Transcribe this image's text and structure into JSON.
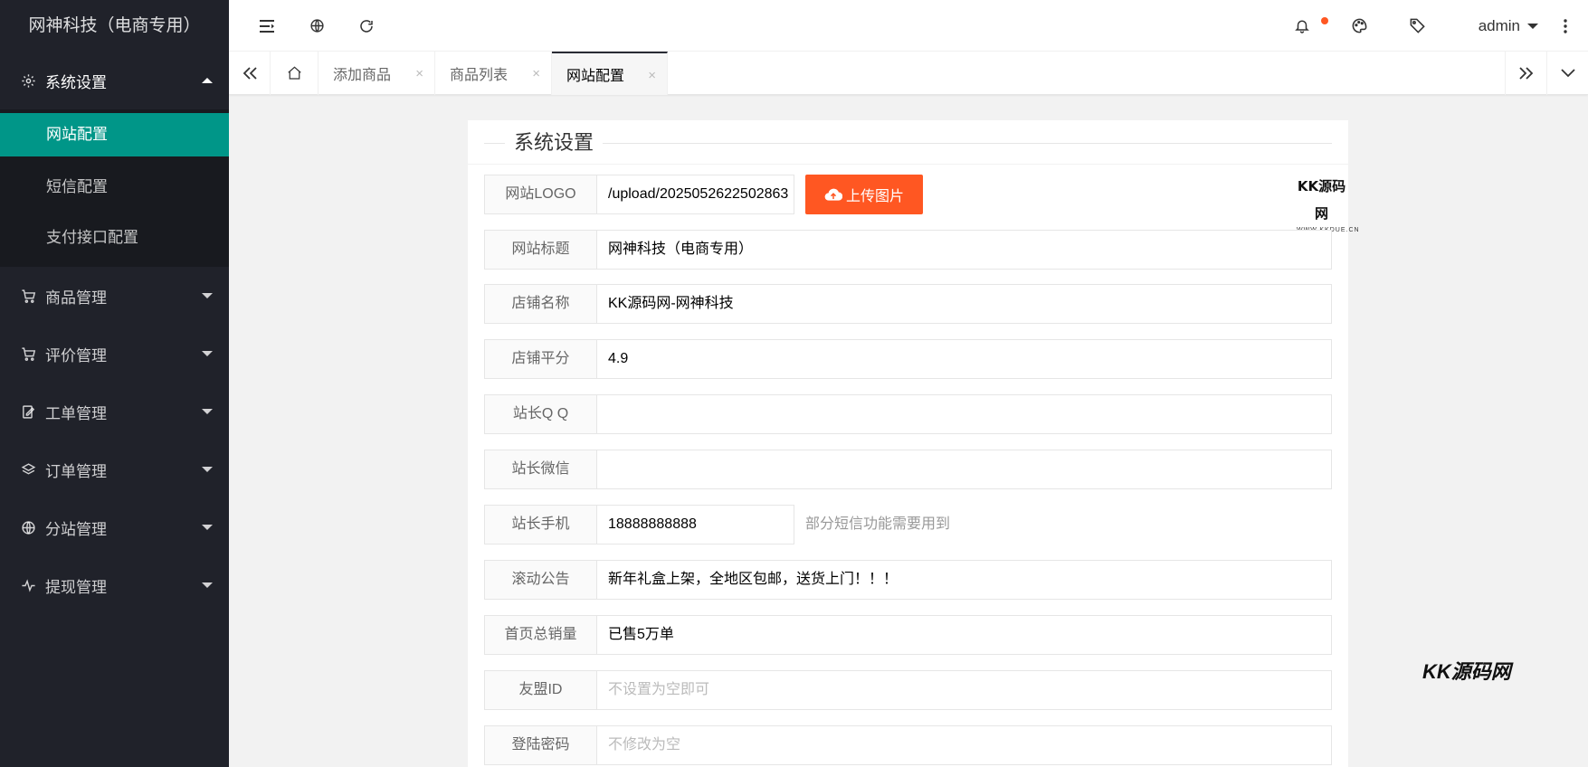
{
  "app": {
    "title": "网神科技（电商专用）"
  },
  "sidebar": {
    "groups": [
      {
        "label": "系统设置",
        "icon": "gear-icon",
        "open": true,
        "children": [
          {
            "label": "网站配置",
            "active": true
          },
          {
            "label": "短信配置"
          },
          {
            "label": "支付接口配置"
          }
        ]
      },
      {
        "label": "商品管理",
        "icon": "cart-icon"
      },
      {
        "label": "评价管理",
        "icon": "cart-icon"
      },
      {
        "label": "工单管理",
        "icon": "edit-icon"
      },
      {
        "label": "订单管理",
        "icon": "layers-icon"
      },
      {
        "label": "分站管理",
        "icon": "globe-icon"
      },
      {
        "label": "提现管理",
        "icon": "pulse-icon"
      }
    ]
  },
  "header": {
    "user": "admin",
    "icons": [
      "menu-toggle-icon",
      "globe-icon",
      "refresh-icon",
      "bell-icon",
      "palette-icon",
      "tag-icon",
      "more-vertical-icon"
    ],
    "accent": "#ff5722"
  },
  "tabs": {
    "items": [
      {
        "label": "添加商品",
        "active": false
      },
      {
        "label": "商品列表",
        "active": false
      },
      {
        "label": "网站配置",
        "active": true
      }
    ],
    "close_glyph": "×"
  },
  "form": {
    "legend": "系统设置",
    "fields": [
      {
        "label": "网站LOGO",
        "value": "/upload/2025052622502863"
      },
      {
        "label": "网站标题",
        "value": "网神科技（电商专用）"
      },
      {
        "label": "店铺名称",
        "value": "KK源码网-网神科技"
      },
      {
        "label": "店铺平分",
        "value": "4.9"
      },
      {
        "label": "站长Q Q",
        "value": ""
      },
      {
        "label": "站长微信",
        "value": ""
      },
      {
        "label": "站长手机",
        "value": "18888888888",
        "aux": "部分短信功能需要用到"
      },
      {
        "label": "滚动公告",
        "value": "新年礼盒上架，全地区包邮，送货上门！！！"
      },
      {
        "label": "首页总销量",
        "value": "已售5万单"
      },
      {
        "label": "友盟ID",
        "value": "",
        "placeholder": "不设置为空即可"
      },
      {
        "label": "登陆密码",
        "value": "",
        "placeholder": "不修改为空"
      }
    ],
    "upload_label": "上传图片",
    "logo_preview_text": "KK源码网",
    "logo_preview_sub": "WWW.KKDUE.CN"
  },
  "watermark": "KK源码网",
  "colors": {
    "sidebar_bg": "#20222a",
    "active_item": "#009688",
    "upload_button": "#ff5722"
  }
}
